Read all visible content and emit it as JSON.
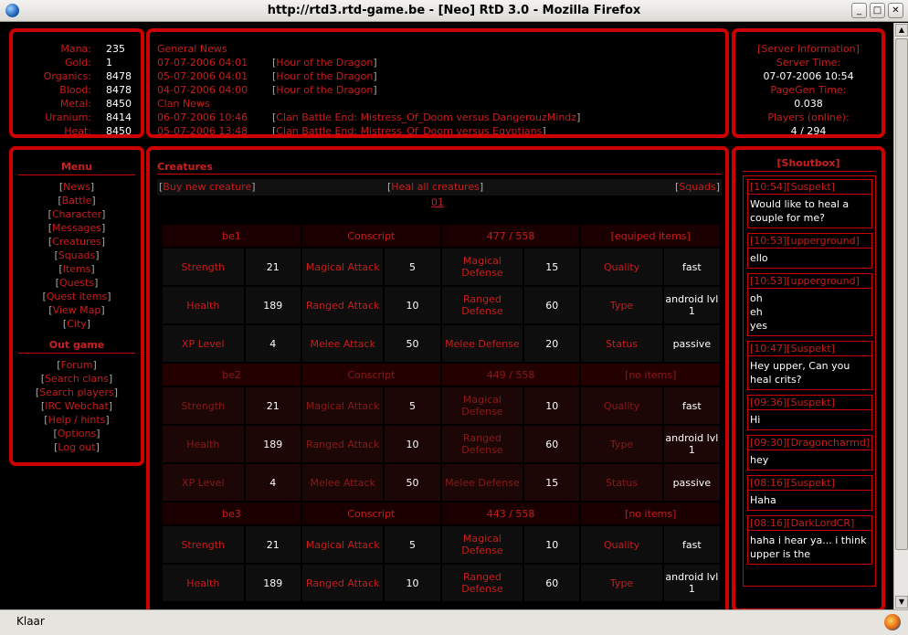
{
  "window": {
    "title": "http://rtd3.rtd-game.be - [Neo] RtD 3.0 - Mozilla Firefox",
    "buttons": {
      "minimize": "_",
      "maximize": "□",
      "close": "✕"
    },
    "status": "Klaar"
  },
  "resources": [
    {
      "label": "Mana:",
      "value": "235"
    },
    {
      "label": "Gold:",
      "value": "1"
    },
    {
      "label": "Organics:",
      "value": "8478"
    },
    {
      "label": "Blood:",
      "value": "8478"
    },
    {
      "label": "Metal:",
      "value": "8450"
    },
    {
      "label": "Uranium:",
      "value": "8414"
    },
    {
      "label": "Heat:",
      "value": "8450"
    }
  ],
  "news": {
    "general_title": "General News",
    "general": [
      {
        "date": "07-07-2006 04:01",
        "text": "Hour of the Dragon"
      },
      {
        "date": "05-07-2006 04:01",
        "text": "Hour of the Dragon"
      },
      {
        "date": "04-07-2006 04:00",
        "text": "Hour of the Dragon"
      }
    ],
    "clan_title": "Clan News",
    "clan": [
      {
        "date": "06-07-2006 10:46",
        "text": "Clan Battle End: Mistress_Of_Doom versus DangerouzMindz"
      },
      {
        "date": "05-07-2006 13:48",
        "text": "Clan Battle End: Mistress_Of_Doom versus Egyptians"
      }
    ]
  },
  "server": {
    "title": "[Server Information]",
    "time_label": "Server Time:",
    "time": "07-07-2006 10:54",
    "pagegen_label": "PageGen Time:",
    "pagegen": "0.038",
    "players_label": "Players (online):",
    "players": "4 / 294"
  },
  "menu": {
    "title": "Menu",
    "items": [
      "News",
      "Battle",
      "Character",
      "Messages",
      "Creatures",
      "Squads",
      "Items",
      "Quests",
      "Quest items",
      "View Map",
      "City"
    ],
    "outgame_title": "Out game",
    "outgame_items": [
      "Forum",
      "Search clans",
      "Search players",
      "IRC Webchat",
      "Help / hints",
      "Options",
      "Log out"
    ]
  },
  "creatures": {
    "title": "Creatures",
    "buy": "Buy new creature",
    "heal": "Heal all creatures",
    "squads": "Squads",
    "page": "01",
    "list": [
      {
        "name": "be1",
        "class": "Conscript",
        "hp": "477 / 558",
        "items": "equiped items",
        "rows": [
          [
            "Strength",
            "21",
            "Magical Attack",
            "5",
            "Magical Defense",
            "15",
            "Quality",
            "fast"
          ],
          [
            "Health",
            "189",
            "Ranged Attack",
            "10",
            "Ranged Defense",
            "60",
            "Type",
            "android lvl 1"
          ],
          [
            "XP Level",
            "4",
            "Melee Attack",
            "50",
            "Melee Defense",
            "20",
            "Status",
            "passive"
          ]
        ]
      },
      {
        "name": "be2",
        "class": "Conscript",
        "hp": "449 / 558",
        "items": "no items",
        "rows": [
          [
            "Strength",
            "21",
            "Magical Attack",
            "5",
            "Magical Defense",
            "10",
            "Quality",
            "fast"
          ],
          [
            "Health",
            "189",
            "Ranged Attack",
            "10",
            "Ranged Defense",
            "60",
            "Type",
            "android lvl 1"
          ],
          [
            "XP Level",
            "4",
            "Melee Attack",
            "50",
            "Melee Defense",
            "15",
            "Status",
            "passive"
          ]
        ]
      },
      {
        "name": "be3",
        "class": "Conscript",
        "hp": "443 / 558",
        "items": "no items",
        "rows": [
          [
            "Strength",
            "21",
            "Magical Attack",
            "5",
            "Magical Defense",
            "10",
            "Quality",
            "fast"
          ],
          [
            "Health",
            "189",
            "Ranged Attack",
            "10",
            "Ranged Defense",
            "60",
            "Type",
            "android lvl 1"
          ]
        ]
      }
    ]
  },
  "shoutbox": {
    "title": "[Shoutbox]",
    "messages": [
      {
        "time": "10:54",
        "user": "Suspekt",
        "lines": [
          "Would like to heal a couple for me?"
        ]
      },
      {
        "time": "10:53",
        "user": "upperground",
        "lines": [
          "ello"
        ]
      },
      {
        "time": "10:53",
        "user": "upperground",
        "lines": [
          "oh",
          "eh",
          "yes"
        ]
      },
      {
        "time": "10:47",
        "user": "Suspekt",
        "lines": [
          "Hey upper, Can you heal crits?"
        ]
      },
      {
        "time": "09:36",
        "user": "Suspekt",
        "lines": [
          "Hi"
        ]
      },
      {
        "time": "09:30",
        "user": "Dragoncharmd",
        "lines": [
          "hey"
        ]
      },
      {
        "time": "08:16",
        "user": "Suspekt",
        "lines": [
          "Haha"
        ]
      },
      {
        "time": "08:16",
        "user": "DarkLordCR",
        "lines": [
          "haha i hear ya... i think upper is the"
        ]
      }
    ]
  }
}
